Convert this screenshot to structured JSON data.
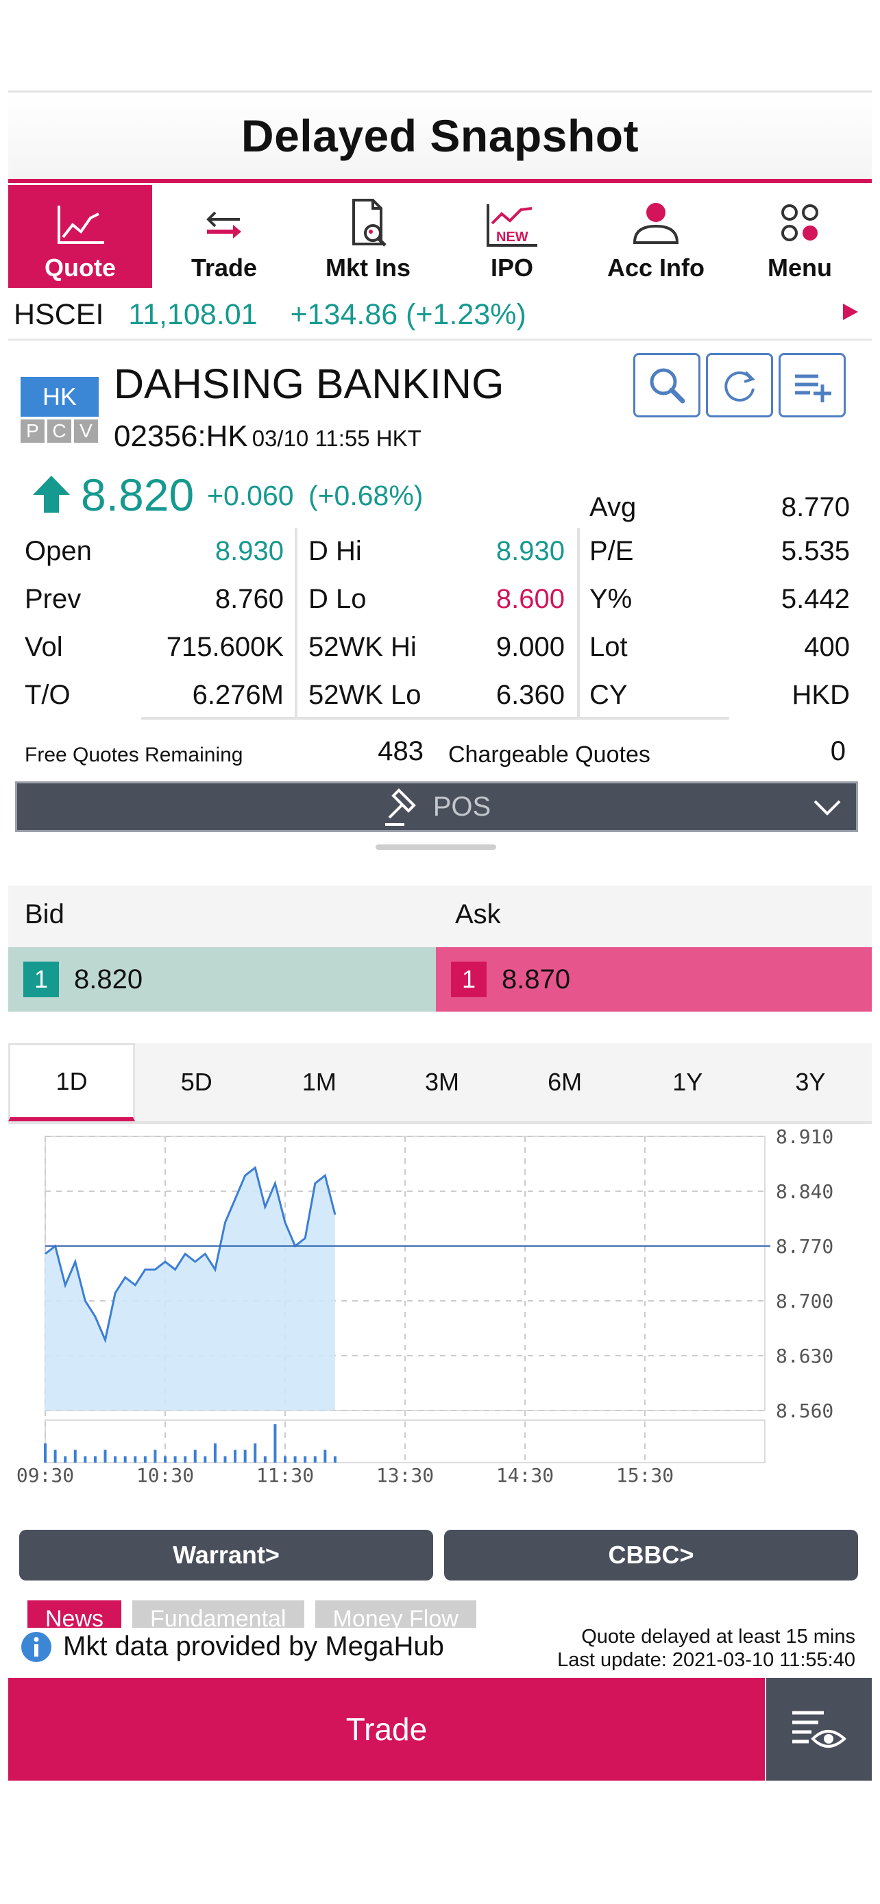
{
  "header": {
    "title": "Delayed Snapshot"
  },
  "nav": {
    "items": [
      {
        "label": "Quote",
        "icon": "chart-line-icon",
        "active": true
      },
      {
        "label": "Trade",
        "icon": "swap-arrows-icon"
      },
      {
        "label": "Mkt Ins",
        "icon": "document-search-icon"
      },
      {
        "label": "IPO",
        "icon": "new-chart-icon",
        "badge": "NEW"
      },
      {
        "label": "Acc Info",
        "icon": "user-icon"
      },
      {
        "label": "Menu",
        "icon": "grid-circles-icon"
      }
    ]
  },
  "index_bar": {
    "name": "HSCEI",
    "value": "11,108.01",
    "change": "+134.86 (+1.23%)"
  },
  "stock": {
    "exchange": "HK",
    "flags": [
      "P",
      "C",
      "V"
    ],
    "name": "DAHSING BANKING",
    "code": "02356:HK",
    "time": "03/10 11:55 HKT",
    "price": "8.820",
    "change": "+0.060",
    "change_pct": "(+0.68%)"
  },
  "stats": {
    "col1": [
      {
        "label": "Open",
        "value": "8.930"
      },
      {
        "label": "Prev",
        "value": "8.760"
      },
      {
        "label": "Vol",
        "value": "715.600K"
      },
      {
        "label": "T/O",
        "value": "6.276M"
      }
    ],
    "col2": [
      {
        "label": "D Hi",
        "value": "8.930"
      },
      {
        "label": "D Lo",
        "value": "8.600"
      },
      {
        "label": "52WK Hi",
        "value": "9.000"
      },
      {
        "label": "52WK Lo",
        "value": "6.360"
      }
    ],
    "col3": [
      {
        "label": "Avg",
        "value": "8.770"
      },
      {
        "label": "P/E",
        "value": "5.535"
      },
      {
        "label": "Y%",
        "value": "5.442"
      },
      {
        "label": "Lot",
        "value": "400"
      },
      {
        "label": "CY",
        "value": "HKD"
      }
    ]
  },
  "quotes": {
    "free_label": "Free Quotes Remaining",
    "free_value": "483",
    "chargeable_label": "Chargeable Quotes",
    "chargeable_value": "0"
  },
  "pos": {
    "label": "POS"
  },
  "orderbook": {
    "bid_label": "Bid",
    "ask_label": "Ask",
    "bid_queue": "1",
    "bid_price": "8.820",
    "ask_queue": "1",
    "ask_price": "8.870"
  },
  "periods": [
    "1D",
    "5D",
    "1M",
    "3M",
    "6M",
    "1Y",
    "3Y"
  ],
  "chart_data": {
    "type": "area",
    "x_ticks": [
      "09:30",
      "10:30",
      "11:30",
      "13:30",
      "14:30",
      "15:30"
    ],
    "y_ticks": [
      "8.910",
      "8.840",
      "8.770",
      "8.700",
      "8.630",
      "8.560"
    ],
    "ylim": [
      8.56,
      8.91
    ],
    "reference_line": 8.77,
    "grid": true,
    "x": [
      "09:30",
      "09:35",
      "09:40",
      "09:45",
      "09:50",
      "09:55",
      "10:00",
      "10:05",
      "10:10",
      "10:15",
      "10:20",
      "10:25",
      "10:30",
      "10:35",
      "10:40",
      "10:45",
      "10:50",
      "10:55",
      "11:00",
      "11:05",
      "11:10",
      "11:15",
      "11:20",
      "11:25",
      "11:30",
      "11:35",
      "11:40",
      "11:45",
      "11:50",
      "11:55"
    ],
    "values": [
      8.76,
      8.77,
      8.72,
      8.75,
      8.7,
      8.68,
      8.65,
      8.71,
      8.73,
      8.72,
      8.74,
      8.74,
      8.75,
      8.74,
      8.76,
      8.75,
      8.76,
      8.74,
      8.8,
      8.83,
      8.86,
      8.87,
      8.82,
      8.85,
      8.8,
      8.77,
      8.78,
      8.85,
      8.86,
      8.81
    ],
    "volume": [
      3,
      2,
      1,
      2,
      1,
      1,
      2,
      1,
      1,
      1,
      1,
      2,
      1,
      1,
      1,
      2,
      1,
      3,
      1,
      2,
      2,
      3,
      1,
      6,
      1,
      1,
      1,
      1,
      2,
      1
    ],
    "fill_color": "#cfe8fb",
    "line_color": "#3b7fd4"
  },
  "buttons": {
    "warrant": "Warrant>",
    "cbbc": "CBBC>"
  },
  "bottom_tabs": [
    "News",
    "Fundamental",
    "Money Flow"
  ],
  "footer": {
    "provider": "Mkt data provided by MegaHub",
    "delay_note": "Quote delayed at least 15 mins",
    "last_update": "Last update: 2021-03-10 11:55:40",
    "trade": "Trade"
  },
  "colors": {
    "accent": "#d4145a",
    "up": "#16998f",
    "dark": "#4a4f5c"
  }
}
